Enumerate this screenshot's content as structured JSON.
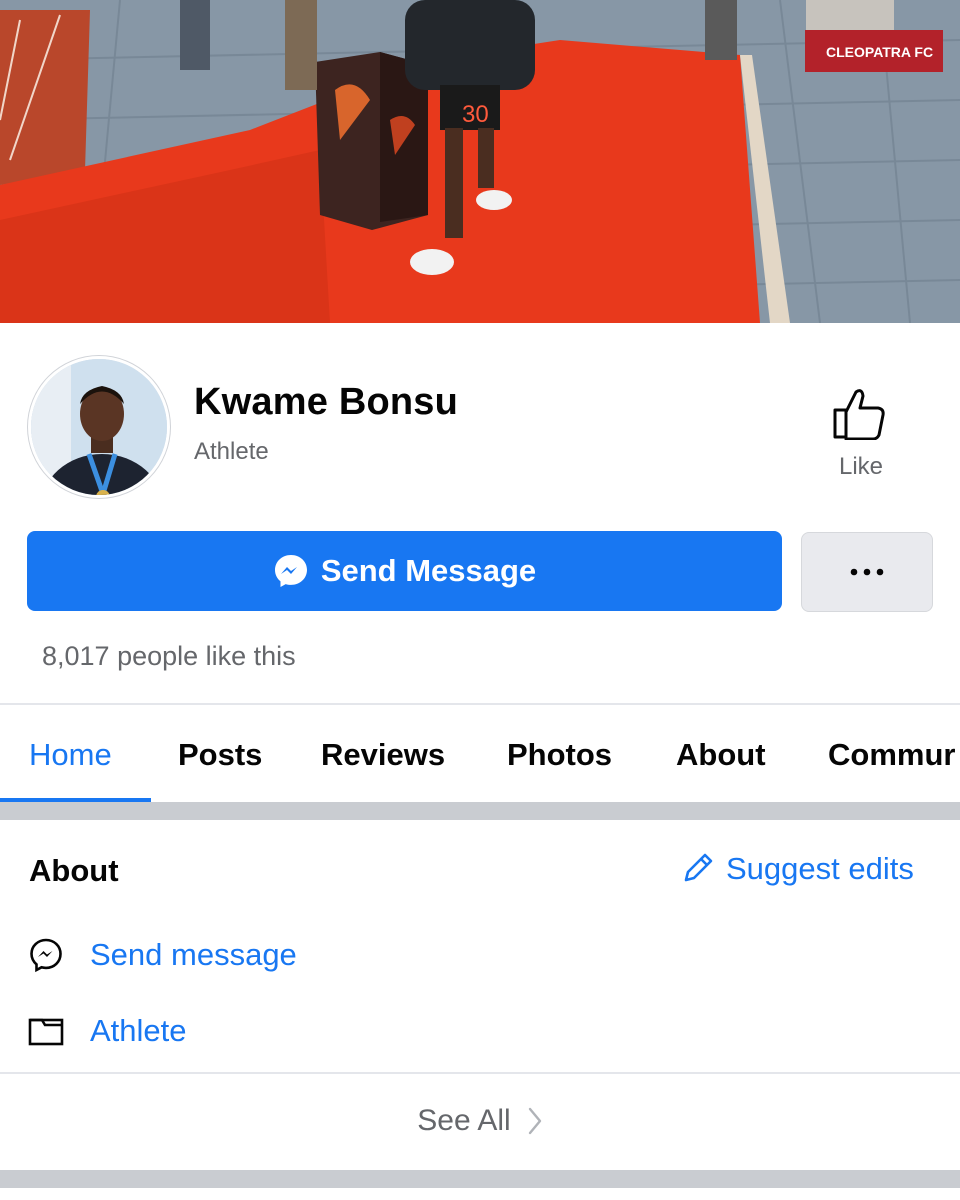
{
  "cover": {
    "alt_text": "CLEOPATRA FC",
    "jersey_number": "30"
  },
  "profile": {
    "name": "Kwame Bonsu",
    "category": "Athlete",
    "like_label": "Like",
    "send_message_label": "Send Message",
    "more_label": "•••",
    "likes_text": "8,017 people like this"
  },
  "tabs": [
    {
      "label": "Home",
      "active": true
    },
    {
      "label": "Posts"
    },
    {
      "label": "Reviews"
    },
    {
      "label": "Photos"
    },
    {
      "label": "About"
    },
    {
      "label": "Commur"
    }
  ],
  "about": {
    "title": "About",
    "suggest_edits": "Suggest edits",
    "items": [
      {
        "icon": "messenger-icon",
        "label": "Send message"
      },
      {
        "icon": "category-icon",
        "label": "Athlete"
      }
    ],
    "see_all": "See All"
  },
  "colors": {
    "accent": "#1877f2",
    "muted": "#65676b",
    "carpet": "#e8391c"
  }
}
